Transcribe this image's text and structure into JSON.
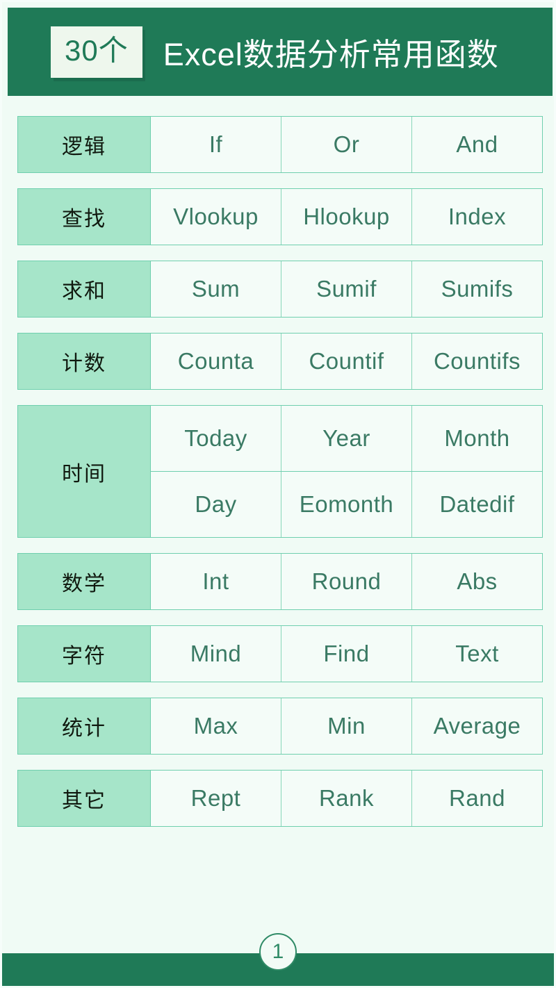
{
  "header": {
    "badge": "30个",
    "title": "Excel数据分析常用函数",
    "background_color": "#1f7a57",
    "badge_background": "#eef7ed",
    "title_color": "#ffffff"
  },
  "colors": {
    "page_background": "#f0fbf5",
    "category_cell": "#a6e5c9",
    "function_cell": "#f4fcf8",
    "function_text": "#3a7a64",
    "border": "#6fcfae",
    "accent_green": "#1f7a57"
  },
  "table": {
    "rows": [
      {
        "category": "逻辑",
        "lines": [
          [
            "If",
            "Or",
            "And"
          ]
        ]
      },
      {
        "category": "查找",
        "lines": [
          [
            "Vlookup",
            "Hlookup",
            "Index"
          ]
        ]
      },
      {
        "category": "求和",
        "lines": [
          [
            "Sum",
            "Sumif",
            "Sumifs"
          ]
        ]
      },
      {
        "category": "计数",
        "lines": [
          [
            "Counta",
            "Countif",
            "Countifs"
          ]
        ]
      },
      {
        "category": "时间",
        "lines": [
          [
            "Today",
            "Year",
            "Month"
          ],
          [
            "Day",
            "Eomonth",
            "Datedif"
          ]
        ]
      },
      {
        "category": "数学",
        "lines": [
          [
            "Int",
            "Round",
            "Abs"
          ]
        ]
      },
      {
        "category": "字符",
        "lines": [
          [
            "Mind",
            "Find",
            "Text"
          ]
        ]
      },
      {
        "category": "统计",
        "lines": [
          [
            "Max",
            "Min",
            "Average"
          ]
        ]
      },
      {
        "category": "其它",
        "lines": [
          [
            "Rept",
            "Rank",
            "Rand"
          ]
        ]
      }
    ]
  },
  "footer": {
    "page_number": "1"
  }
}
